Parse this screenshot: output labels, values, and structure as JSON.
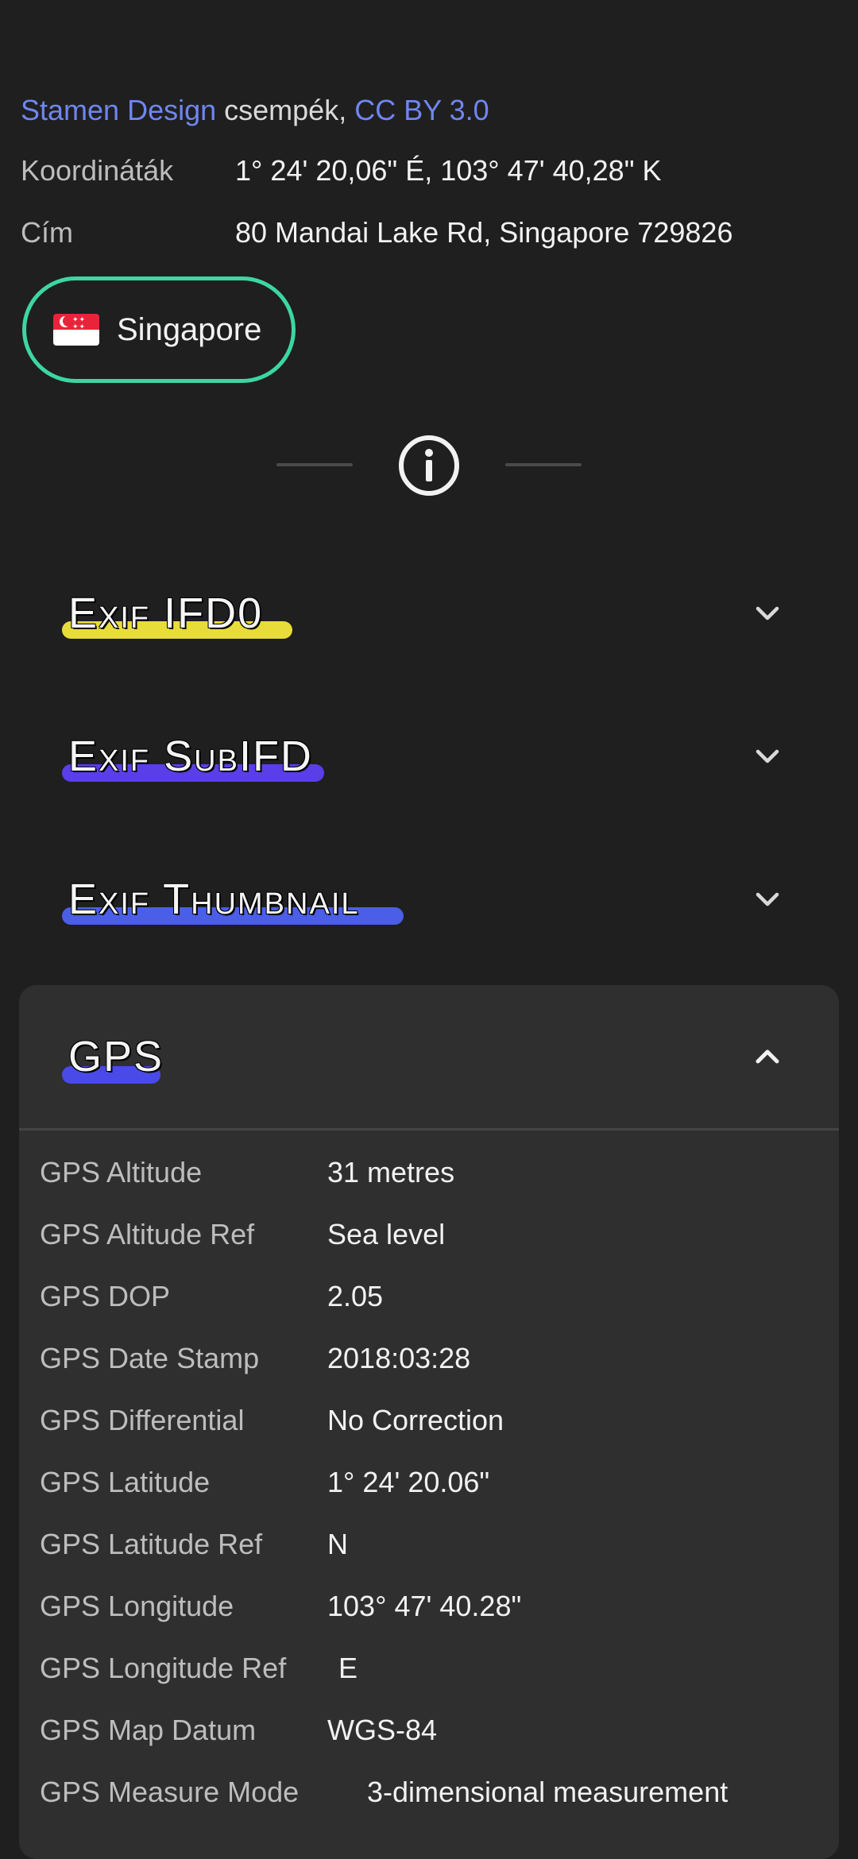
{
  "attribution": {
    "provider": "Stamen Design",
    "middle": " csempék, ",
    "license": "CC BY 3.0"
  },
  "location": {
    "coords_label": "Koordináták",
    "coords_value": "1° 24' 20,06\" É, 103° 47' 40,28\" K",
    "address_label": "Cím",
    "address_value": "80 Mandai Lake Rd, Singapore 729826",
    "country": "Singapore"
  },
  "colors": {
    "chip_border": "#3dd6a3",
    "ifd0_highlight": "#e8dc3a",
    "subifd_highlight": "#5a3ee8",
    "thumbnail_highlight": "#4a5ee8",
    "gps_highlight": "#4a4ae8"
  },
  "sections": [
    {
      "title": "Exif IFD0",
      "expanded": false
    },
    {
      "title": "Exif SubIFD",
      "expanded": false
    },
    {
      "title": "Exif Thumbnail",
      "expanded": false
    },
    {
      "title": "GPS",
      "expanded": true
    }
  ],
  "gps_rows": [
    {
      "key": "GPS Altitude",
      "value": "31 metres"
    },
    {
      "key": "GPS Altitude Ref",
      "value": "Sea level"
    },
    {
      "key": "GPS DOP",
      "value": "2.05"
    },
    {
      "key": "GPS Date Stamp",
      "value": "2018:03:28"
    },
    {
      "key": "GPS Differential",
      "value": "No Correction"
    },
    {
      "key": "GPS Latitude",
      "value": "1° 24' 20.06\""
    },
    {
      "key": "GPS Latitude Ref",
      "value": "N"
    },
    {
      "key": "GPS Longitude",
      "value": "103° 47' 40.28\""
    },
    {
      "key": "GPS Longitude Ref",
      "value": "E"
    },
    {
      "key": "GPS Map Datum",
      "value": "WGS-84"
    },
    {
      "key": "GPS Measure Mode",
      "value": "3-dimensional measurement"
    }
  ]
}
